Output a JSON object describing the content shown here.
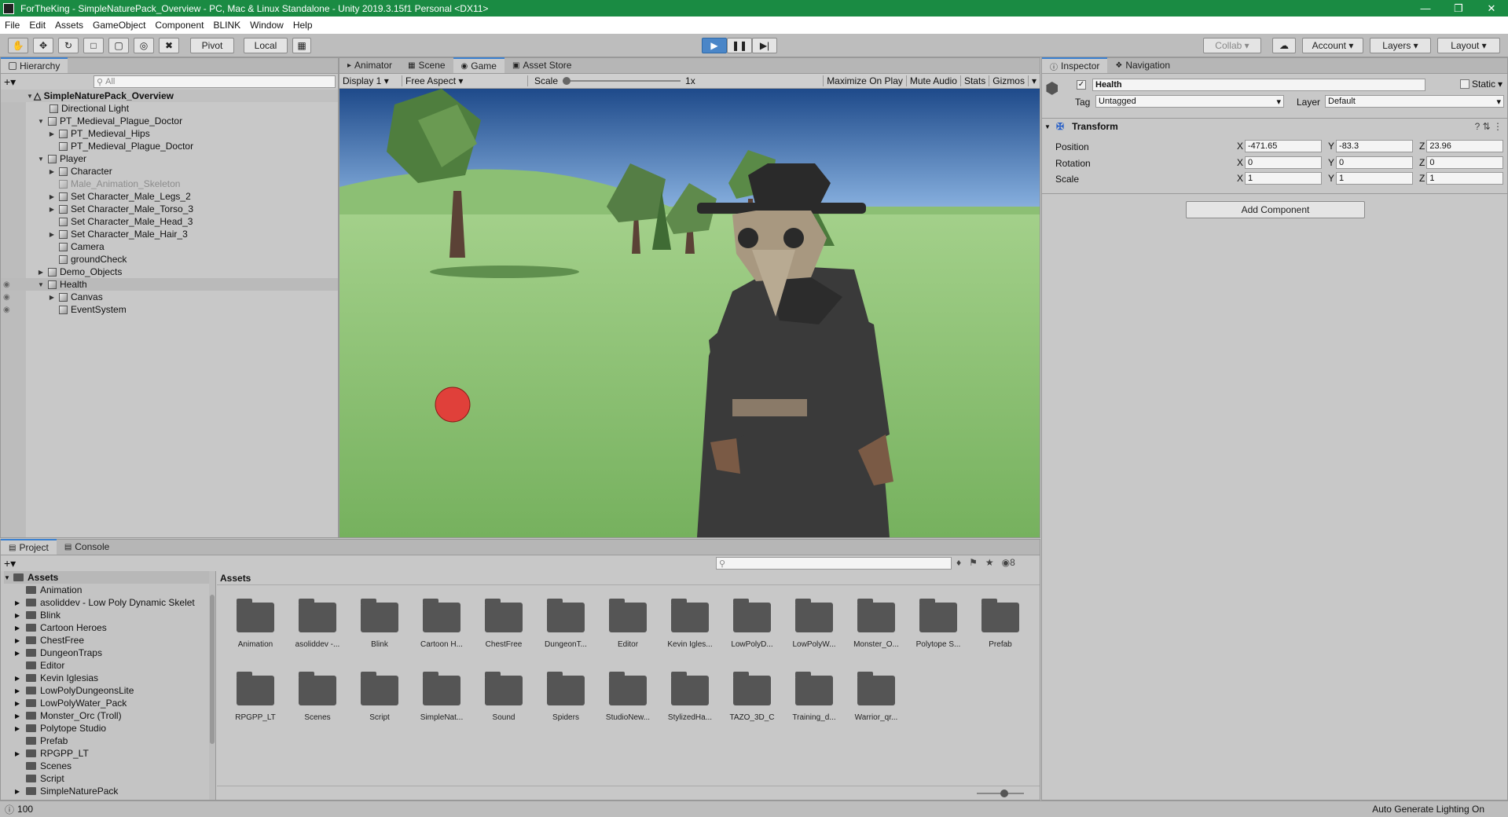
{
  "window": {
    "title": "ForTheKing - SimpleNaturePack_Overview - PC, Mac & Linux Standalone - Unity 2019.3.15f1 Personal <DX11>"
  },
  "menu": [
    "File",
    "Edit",
    "Assets",
    "GameObject",
    "Component",
    "BLINK",
    "Window",
    "Help"
  ],
  "toolbar": {
    "pivot": "Pivot",
    "local": "Local",
    "collab": "Collab",
    "account": "Account",
    "layers": "Layers",
    "layout": "Layout"
  },
  "hierarchy": {
    "title": "Hierarchy",
    "search_placeholder": "All",
    "root": "SimpleNaturePack_Overview",
    "items": [
      "Directional Light",
      "PT_Medieval_Plague_Doctor",
      "PT_Medieval_Hips",
      "PT_Medieval_Plague_Doctor",
      "Player",
      "Character",
      "Male_Animation_Skeleton",
      "Set Character_Male_Legs_2",
      "Set Character_Male_Torso_3",
      "Set Character_Male_Head_3",
      "Set Character_Male_Hair_3",
      "Camera",
      "groundCheck",
      "Demo_Objects",
      "Health",
      "Canvas",
      "EventSystem"
    ]
  },
  "center_tabs": {
    "animator": "Animator",
    "scene": "Scene",
    "game": "Game",
    "asset_store": "Asset Store"
  },
  "game_bar": {
    "display": "Display 1",
    "aspect": "Free Aspect",
    "scale_label": "Scale",
    "scale_value": "1x",
    "maximize": "Maximize On Play",
    "mute": "Mute Audio",
    "stats": "Stats",
    "gizmos": "Gizmos"
  },
  "inspector": {
    "tab": "Inspector",
    "nav_tab": "Navigation",
    "object_name": "Health",
    "static": "Static",
    "tag_label": "Tag",
    "tag_value": "Untagged",
    "layer_label": "Layer",
    "layer_value": "Default",
    "component": "Transform",
    "position": {
      "label": "Position",
      "x": "-471.65",
      "y": "-83.3",
      "z": "23.96"
    },
    "rotation": {
      "label": "Rotation",
      "x": "0",
      "y": "0",
      "z": "0"
    },
    "scale": {
      "label": "Scale",
      "x": "1",
      "y": "1",
      "z": "1"
    },
    "add_component": "Add Component"
  },
  "project": {
    "tab": "Project",
    "console_tab": "Console",
    "breadcrumb": "Assets",
    "badge": "8",
    "tree_root": "Assets",
    "tree": [
      "Animation",
      "asoliddev - Low Poly Dynamic Skelet",
      "Blink",
      "Cartoon Heroes",
      "ChestFree",
      "DungeonTraps",
      "Editor",
      "Kevin Iglesias",
      "LowPolyDungeonsLite",
      "LowPolyWater_Pack",
      "Monster_Orc (Troll)",
      "Polytope Studio",
      "Prefab",
      "RPGPP_LT",
      "Scenes",
      "Script",
      "SimpleNaturePack"
    ],
    "folders": [
      "Animation",
      "asoliddev -...",
      "Blink",
      "Cartoon H...",
      "ChestFree",
      "DungeonT...",
      "Editor",
      "Kevin Igles...",
      "LowPolyD...",
      "LowPolyW...",
      "Monster_O...",
      "Polytope S...",
      "Prefab",
      "RPGPP_LT",
      "Scenes",
      "Script",
      "SimpleNat...",
      "Sound",
      "Spiders",
      "StudioNew...",
      "StylizedHa...",
      "TAZO_3D_C",
      "Training_d...",
      "Warrior_qr..."
    ]
  },
  "status": {
    "count": "100",
    "right": "Auto Generate Lighting On"
  }
}
